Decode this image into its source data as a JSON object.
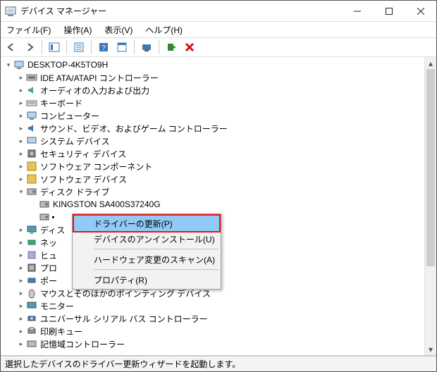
{
  "titlebar": {
    "title": "デバイス マネージャー"
  },
  "menus": {
    "file": "ファイル(F)",
    "action": "操作(A)",
    "view": "表示(V)",
    "help": "ヘルプ(H)"
  },
  "root": {
    "label": "DESKTOP-4K5TO9H"
  },
  "categories": [
    {
      "label": "IDE ATA/ATAPI コントローラー",
      "icon": "ide"
    },
    {
      "label": "オーディオの入力および出力",
      "icon": "audio"
    },
    {
      "label": "キーボード",
      "icon": "keyboard"
    },
    {
      "label": "コンピューター",
      "icon": "computer"
    },
    {
      "label": "サウンド、ビデオ、およびゲーム コントローラー",
      "icon": "sound"
    },
    {
      "label": "システム デバイス",
      "icon": "system"
    },
    {
      "label": "セキュリティ デバイス",
      "icon": "security"
    },
    {
      "label": "ソフトウェア コンポーネント",
      "icon": "swcomp"
    },
    {
      "label": "ソフトウェア デバイス",
      "icon": "swdev"
    }
  ],
  "disk": {
    "category_label": "ディスク ドライブ",
    "device_label": "KINGSTON SA400S37240G",
    "hidden_device_prefix": ""
  },
  "cats_after": [
    {
      "label": "ディス",
      "icon": "display"
    },
    {
      "label": "ネッ",
      "icon": "network"
    },
    {
      "label": "ヒュ",
      "icon": "hid"
    },
    {
      "label": "プロ",
      "icon": "cpu"
    },
    {
      "label": "ポー",
      "icon": "port"
    },
    {
      "label": "マウスとそのほかのポインティング デバイス",
      "icon": "mouse"
    },
    {
      "label": "モニター",
      "icon": "monitor"
    },
    {
      "label": "ユニバーサル シリアル バス コントローラー",
      "icon": "usb"
    },
    {
      "label": "印刷キュー",
      "icon": "print"
    },
    {
      "label": "記憶域コントローラー",
      "icon": "storage"
    }
  ],
  "context_menu": {
    "update_driver": "ドライバーの更新(P)",
    "uninstall": "デバイスのアンインストール(U)",
    "scan": "ハードウェア変更のスキャン(A)",
    "properties": "プロパティ(R)"
  },
  "status": "選択したデバイスのドライバー更新ウィザードを起動します。"
}
